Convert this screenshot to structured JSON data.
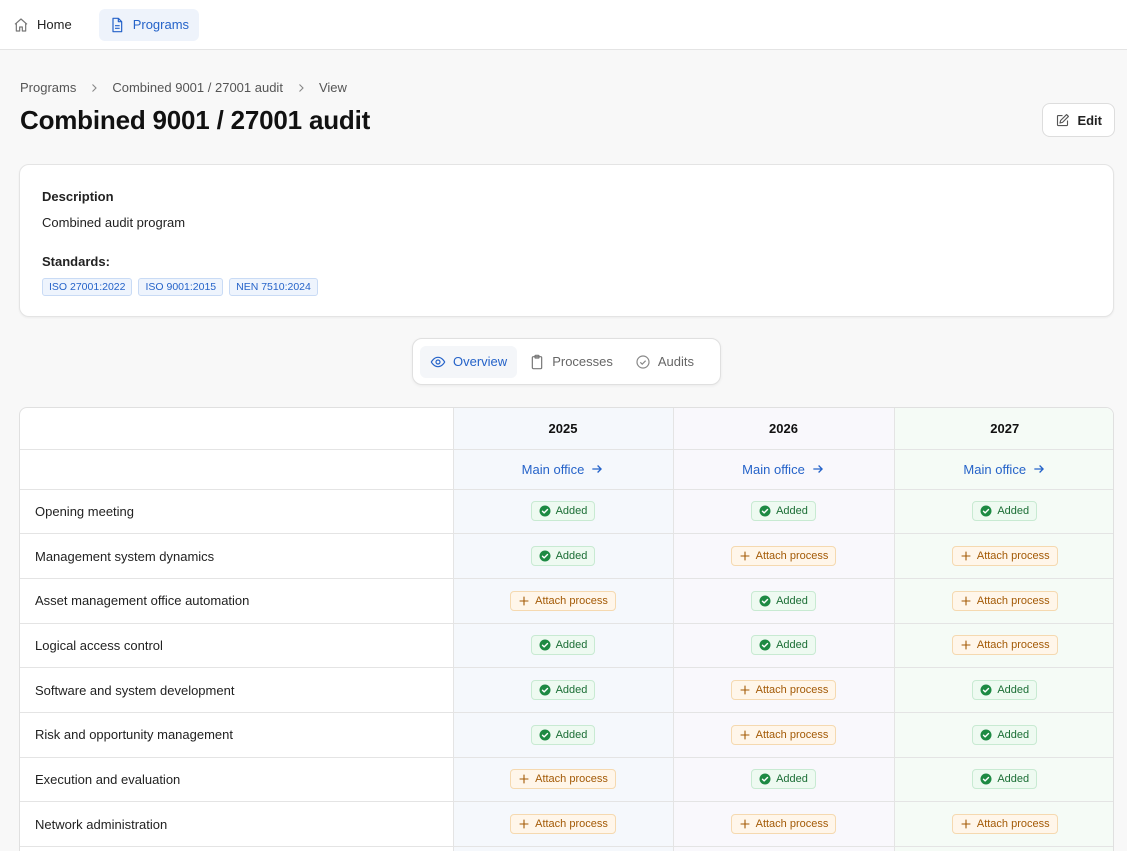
{
  "nav": {
    "home_label": "Home",
    "programs_label": "Programs"
  },
  "breadcrumb": [
    "Programs",
    "Combined 9001 / 27001 audit",
    "View"
  ],
  "page": {
    "title": "Combined 9001 / 27001 audit",
    "edit_label": "Edit"
  },
  "description": {
    "label": "Description",
    "value": "Combined audit program",
    "standards_label": "Standards:",
    "standards": [
      "ISO 27001:2022",
      "ISO 9001:2015",
      "NEN 7510:2024"
    ]
  },
  "tabs": {
    "overview": "Overview",
    "processes": "Processes",
    "audits": "Audits"
  },
  "matrix": {
    "years": [
      "2025",
      "2026",
      "2027"
    ],
    "locations": [
      "Main office",
      "Main office",
      "Main office"
    ],
    "status_labels": {
      "added": "Added",
      "attach": "Attach process"
    },
    "rows": [
      {
        "name": "Opening meeting",
        "statuses": [
          "added",
          "added",
          "added"
        ]
      },
      {
        "name": "Management system dynamics",
        "statuses": [
          "added",
          "attach",
          "attach"
        ]
      },
      {
        "name": "Asset management office automation",
        "statuses": [
          "attach",
          "added",
          "attach"
        ]
      },
      {
        "name": "Logical access control",
        "statuses": [
          "added",
          "added",
          "attach"
        ]
      },
      {
        "name": "Software and system development",
        "statuses": [
          "added",
          "attach",
          "added"
        ]
      },
      {
        "name": "Risk and opportunity management",
        "statuses": [
          "added",
          "attach",
          "added"
        ]
      },
      {
        "name": "Execution and evaluation",
        "statuses": [
          "attach",
          "added",
          "added"
        ]
      },
      {
        "name": "Network administration",
        "statuses": [
          "attach",
          "attach",
          "attach"
        ]
      },
      {
        "name": "",
        "statuses": [
          "",
          "",
          ""
        ]
      }
    ]
  },
  "colors": {
    "accent": "#2563c9",
    "added_text": "#1b6e35",
    "added_icon": "#1d8a43",
    "attach_text": "#a35a06"
  }
}
